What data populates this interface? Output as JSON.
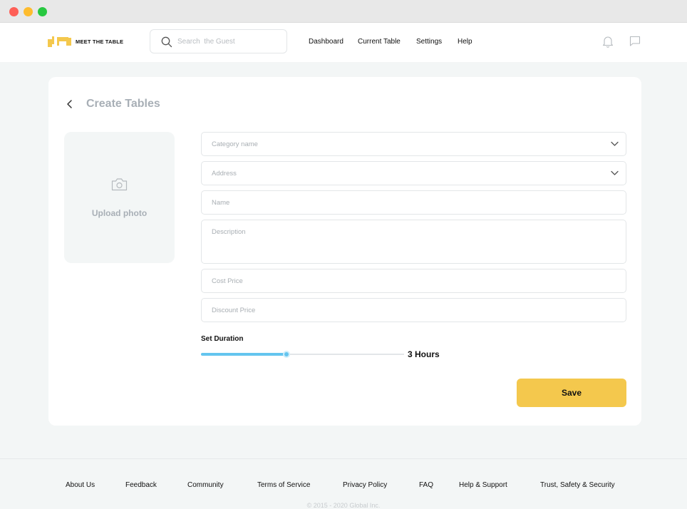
{
  "brand": {
    "name": "MEET THE TABLE",
    "accent": "#f4c84d"
  },
  "search": {
    "placeholder": "Search  the Guest",
    "icon": "search-icon"
  },
  "nav": {
    "dashboard": "Dashboard",
    "current_table": "Current Table",
    "settings": "Settings",
    "help": "Help"
  },
  "header_icons": {
    "notifications": "bell-icon",
    "messages": "chat-icon"
  },
  "page": {
    "title": "Create Tables",
    "back_icon": "chevron-left-icon"
  },
  "upload": {
    "label": "Upload photo",
    "icon": "camera-icon"
  },
  "form": {
    "category": {
      "placeholder": "Category name"
    },
    "address": {
      "placeholder": "Address"
    },
    "name": {
      "placeholder": "Name"
    },
    "description": {
      "placeholder": "Description"
    },
    "cost_price": {
      "placeholder": "Cost Price"
    },
    "discount_price": {
      "placeholder": "Discount Price"
    }
  },
  "duration": {
    "label": "Set Duration",
    "value_text": "3 Hours",
    "slider_fraction": 0.42,
    "slider_color": "#64c5ef"
  },
  "save": {
    "label": "Save"
  },
  "footer": {
    "links": [
      "About Us",
      "Feedback",
      "Community",
      "Terms of Service",
      "Privacy Policy",
      "FAQ",
      "Help & Support",
      "Trust, Safety & Security"
    ],
    "copyright": "© 2015 - 2020 Global Inc."
  }
}
